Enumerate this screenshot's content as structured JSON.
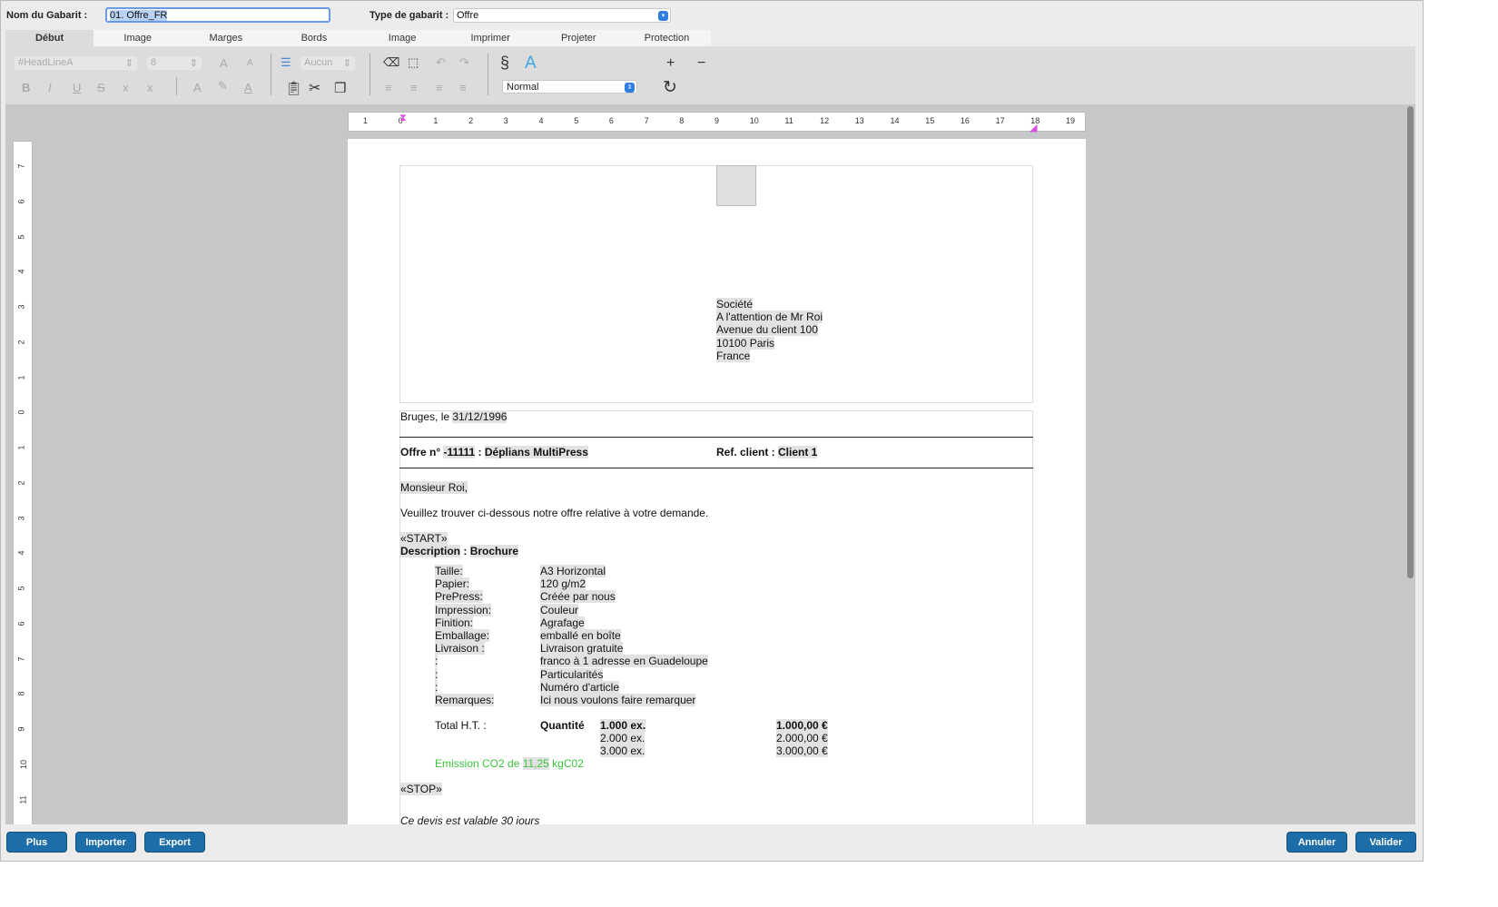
{
  "header": {
    "name_label": "Nom du Gabarit :",
    "name_value": "01. Offre_FR",
    "type_label": "Type de gabarit :",
    "type_value": "Offre"
  },
  "tabs": [
    "Début",
    "Image",
    "Marges",
    "Bords",
    "Image",
    "Imprimer",
    "Projeter",
    "Protection"
  ],
  "toolbar": {
    "style": "#HeadLineA",
    "size": "8",
    "list": "Aucun",
    "paragraph": "Normal"
  },
  "ruler": {
    "h": [
      "1",
      "0",
      "1",
      "2",
      "3",
      "4",
      "5",
      "6",
      "7",
      "8",
      "9",
      "10",
      "11",
      "12",
      "13",
      "14",
      "15",
      "16",
      "17",
      "18",
      "19"
    ],
    "v": [
      "7",
      "6",
      "5",
      "4",
      "3",
      "2",
      "1",
      "0",
      "1",
      "2",
      "3",
      "4",
      "5",
      "6",
      "7",
      "8",
      "9",
      "10",
      "11"
    ]
  },
  "doc": {
    "address": [
      "Société",
      "A l'attention de Mr Roi",
      "Avenue du client 100",
      "10100 Paris",
      "France"
    ],
    "city": "Bruges, le ",
    "date": "31/12/1996",
    "offer_label": "Offre n° ",
    "offer_no": "-11111",
    "offer_sep": " : ",
    "offer_title": "Déplians MultiPress",
    "ref_label": "Ref. client : ",
    "ref_value": "Client 1",
    "greeting": "Monsieur Roi,",
    "intro": "Veuillez trouver ci-dessous notre offre relative à votre demande.",
    "start": "«START»",
    "desc_label": "Description",
    "desc_sep": " : ",
    "desc_value": "Brochure",
    "specs": [
      [
        "Taille:",
        "A3 Horizontal"
      ],
      [
        "Papier:",
        "120 g/m2"
      ],
      [
        "PrePress:",
        "Créée par nous"
      ],
      [
        "Impression:",
        "Couleur"
      ],
      [
        "Finition:",
        "Agrafage"
      ],
      [
        "Emballage:",
        "emballé en boîte"
      ],
      [
        "Livraison :",
        "Livraison gratuite"
      ],
      [
        "  :",
        "franco à 1 adresse en Guadeloupe"
      ],
      [
        "  :",
        "Particularités"
      ],
      [
        "  :",
        "Numéro d'article"
      ],
      [
        "Remarques:",
        "Ici nous voulons faire remarquer"
      ]
    ],
    "total_label": "Total H.T. :",
    "qty_label": "Quantité",
    "prices": [
      [
        "1.000 ex.",
        "1.000,00 €"
      ],
      [
        "2.000 ex.",
        "2.000,00 €"
      ],
      [
        "3.000 ex.",
        "3.000,00 €"
      ]
    ],
    "co2_prefix": "Emission CO2 de ",
    "co2_value": "11,25",
    "co2_unit": " kgC02",
    "stop": "«STOP»",
    "validity": "Ce devis est valable 30 jours"
  },
  "buttons": {
    "plus": "Plus",
    "import": "Importer",
    "export": "Export",
    "cancel": "Annuler",
    "ok": "Valider"
  },
  "colors": {
    "accent": "#1d6ea8",
    "co2": "#3cc43c",
    "margin_marker": "#d94ee0"
  }
}
